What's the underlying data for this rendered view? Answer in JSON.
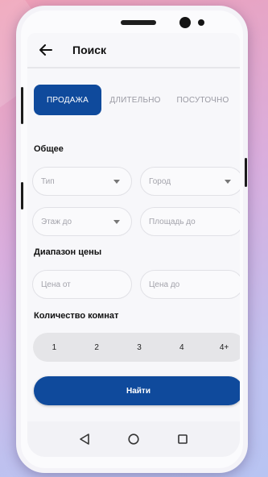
{
  "app": {
    "title": "Поиск"
  },
  "tabs": [
    {
      "label": "ПРОДАЖА",
      "active": true
    },
    {
      "label": "ДЛИТЕЛЬНО",
      "active": false
    },
    {
      "label": "ПОСУТОЧНО",
      "active": false
    }
  ],
  "general": {
    "title": "Общее",
    "type_placeholder": "Тип",
    "city_placeholder": "Город",
    "floor_placeholder": "Этаж до",
    "area_placeholder": "Площадь до"
  },
  "price": {
    "title": "Диапазон цены",
    "from_placeholder": "Цена от",
    "to_placeholder": "Цена до"
  },
  "rooms": {
    "title": "Количество комнат",
    "options": [
      "1",
      "2",
      "3",
      "4",
      "4+"
    ]
  },
  "actions": {
    "search_label": "Найти"
  },
  "icons": {
    "back": "arrow-left-icon",
    "nav_back": "triangle-back-icon",
    "nav_home": "circle-home-icon",
    "nav_recents": "square-recents-icon"
  },
  "colors": {
    "accent": "#0f4a9c",
    "background": "#f7f7fa"
  }
}
